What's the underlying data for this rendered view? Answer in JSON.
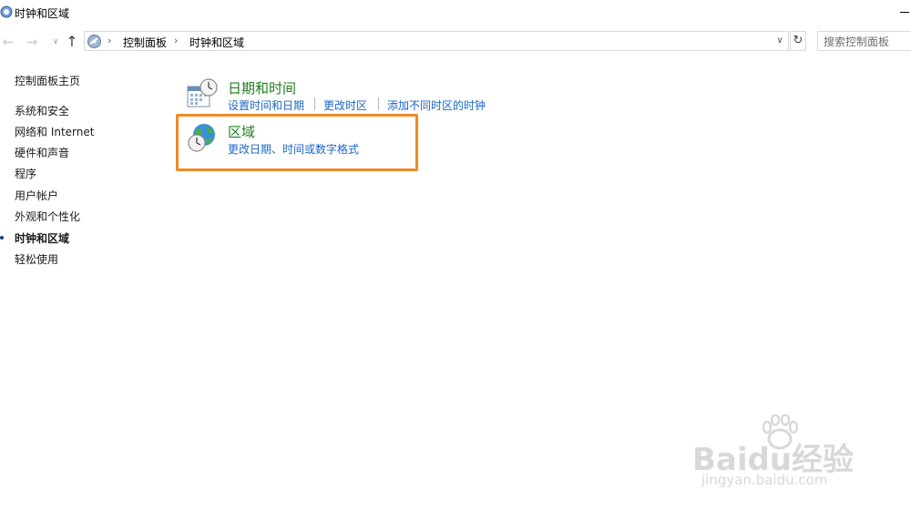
{
  "window": {
    "title": "时钟和区域"
  },
  "nav": {
    "back_icon": "arrow-left-icon",
    "forward_icon": "arrow-right-icon",
    "recent_icon": "chevron-down-icon",
    "up_icon": "arrow-up-icon"
  },
  "address": {
    "icon": "control-panel-icon",
    "crumbs": [
      "控制面板",
      "时钟和区域"
    ],
    "separator": "›"
  },
  "search": {
    "placeholder": "搜索控制面板"
  },
  "sidebar": {
    "home": "控制面板主页",
    "items": [
      {
        "label": "系统和安全",
        "active": false
      },
      {
        "label": "网络和 Internet",
        "active": false
      },
      {
        "label": "硬件和声音",
        "active": false
      },
      {
        "label": "程序",
        "active": false
      },
      {
        "label": "用户帐户",
        "active": false
      },
      {
        "label": "外观和个性化",
        "active": false
      },
      {
        "label": "时钟和区域",
        "active": true
      },
      {
        "label": "轻松使用",
        "active": false
      }
    ]
  },
  "categories": [
    {
      "title": "日期和时间",
      "icon": "calendar-clock-icon",
      "links": [
        "设置时间和日期",
        "更改时区",
        "添加不同时区的时钟"
      ]
    },
    {
      "title": "区域",
      "icon": "globe-clock-icon",
      "links": [
        "更改日期、时间或数字格式"
      ]
    }
  ],
  "highlight": {
    "color": "#f08a24"
  },
  "watermark": {
    "brand": "Baidu经验",
    "url": "jingyan.baidu.com"
  },
  "colors": {
    "category_title": "#1e7e1e",
    "link": "#1a66c8"
  }
}
